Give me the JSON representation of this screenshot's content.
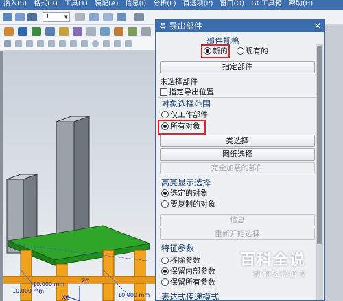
{
  "menu": [
    "插入(S)",
    "格式(R)",
    "工具(T)",
    "装配(A)",
    "信息(I)",
    "分析(L)",
    "首选项(P)",
    "窗口(O)",
    "GC工具箱",
    "帮助(H)"
  ],
  "toolbar": {
    "layer_combo": "1"
  },
  "dialog": {
    "title": "导出部件",
    "part_spec": {
      "label": "部件规格",
      "option_new": "新的",
      "option_existing": "现有的",
      "selected": "新的"
    },
    "specify_part_button": "指定部件",
    "no_part_selected": "未选择部件",
    "specify_export_location": "指定导出位置",
    "object_scope": {
      "label": "对象选择范围",
      "option_work_part": "仅工作部件",
      "option_all_objects": "所有对象",
      "selected": "所有对象"
    },
    "class_selection_button": "类选择",
    "drawing_selection_button": "图纸选择",
    "fully_loaded_parts_button": "完全加载的部件",
    "highlight": {
      "label": "高亮显示选择",
      "option_selected": "选定的对象",
      "option_to_copy": "要复制的对象",
      "selected": "选定的对象"
    },
    "info_button": "信息",
    "restart_button": "重新开始选择",
    "feature_params": {
      "label": "特征参数",
      "option_remove": "移除参数",
      "option_keep_internal": "保留内部参数",
      "option_keep_all": "保留所有参数",
      "selected": "保留内部参数"
    },
    "expression_mode_label": "表达式传递模式"
  },
  "viewport": {
    "dimension_1": "10.000 mm",
    "dimension_2": "10.000 mm",
    "dimension_3": "10.000 mm",
    "axis_zc": "ZC",
    "axis_xc": "XC"
  },
  "watermark": {
    "title": "百科全说",
    "subtitle": "助你轻松解决"
  },
  "colors": {
    "title_bar": "#3b6cab",
    "highlight_red": "#e0242a",
    "plate_green": "#2fa52a",
    "column_orange": "#f2a21c"
  }
}
